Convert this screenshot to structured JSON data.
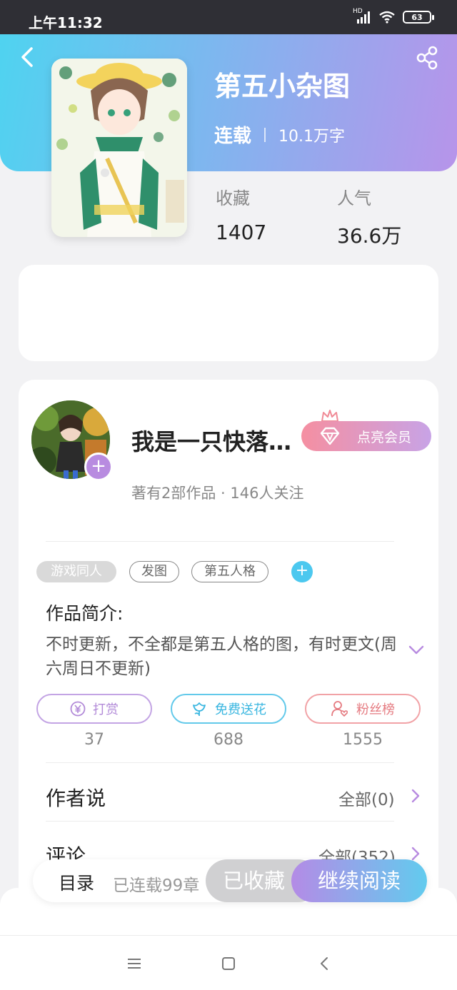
{
  "status_bar": {
    "time": "上午11:32",
    "battery": "63",
    "signal_label": "HD"
  },
  "book": {
    "title": "第五小杂图",
    "status": "连载",
    "word_count": "10.1万字",
    "favorites_label": "收藏",
    "favorites_value": "1407",
    "popularity_label": "人气",
    "popularity_value": "36.6万"
  },
  "author": {
    "name": "我是一只快落…",
    "info": "著有2部作品 · 146人关注",
    "follow_symbol": "+",
    "vip_label": "点亮会员"
  },
  "tags": [
    {
      "label": "游戏同人"
    },
    {
      "label": "发图"
    },
    {
      "label": "第五人格"
    }
  ],
  "tag_add_symbol": "+",
  "intro": {
    "title": "作品简介:",
    "text": "不时更新，不全都是第五人格的图，有时更文(周六周日不更新)"
  },
  "actions": [
    {
      "label": "打赏",
      "count": "37"
    },
    {
      "label": "免费送花",
      "count": "688"
    },
    {
      "label": "粉丝榜",
      "count": "1555"
    }
  ],
  "author_says": {
    "title": "作者说",
    "link": "全部(0)"
  },
  "comments": {
    "title": "评论",
    "link": "全部(352)"
  },
  "bottom_bar": {
    "catalog": "目录",
    "progress": "已连载99章",
    "collected": "已收藏",
    "continue": "继续阅读"
  },
  "colors": {
    "header_start": "#4fd3f0",
    "header_end": "#b794ea",
    "accent_purple": "#b88be0",
    "accent_blue": "#4cc8ef",
    "accent_red": "#e57a80"
  }
}
